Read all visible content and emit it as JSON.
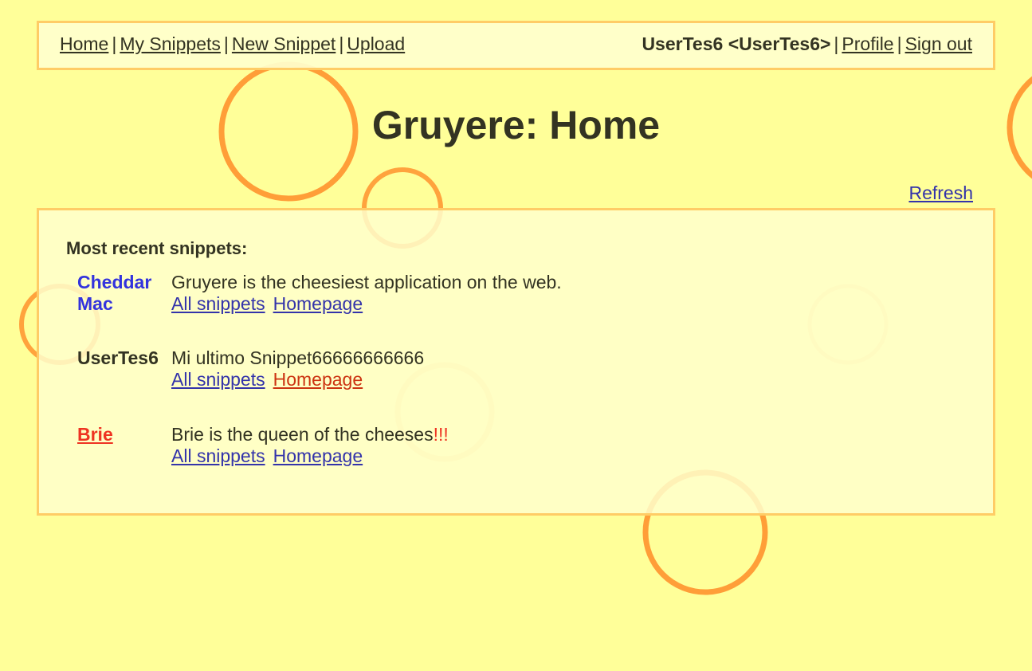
{
  "nav": {
    "home": "Home",
    "my_snippets": "My Snippets",
    "new_snippet": "New Snippet",
    "upload": "Upload",
    "sep": "|",
    "user": "UserTes6 <UserTes6>",
    "profile": "Profile",
    "sign_out": "Sign out"
  },
  "page": {
    "title": "Gruyere: Home",
    "refresh": "Refresh"
  },
  "snippets": {
    "heading": "Most recent snippets:",
    "items": [
      {
        "author": "Cheddar Mac",
        "text": "Gruyere is the cheesiest application on the web.",
        "emphasis": "",
        "all_snippets": "All snippets",
        "homepage": "Homepage"
      },
      {
        "author": "UserTes6",
        "text": "Mi ultimo Snippet66666666666",
        "emphasis": "",
        "all_snippets": "All snippets",
        "homepage": "Homepage"
      },
      {
        "author": "Brie",
        "text": "Brie is the queen of the cheeses",
        "emphasis": "!!!",
        "all_snippets": "All snippets",
        "homepage": "Homepage"
      }
    ]
  },
  "colors": {
    "background": "#ffff99",
    "panel": "#ffffcc",
    "border": "#ffcc66",
    "link": "#3333aa",
    "accent_blue": "#3333dd",
    "accent_red": "#ee3322",
    "bubble": "#ff9933"
  }
}
